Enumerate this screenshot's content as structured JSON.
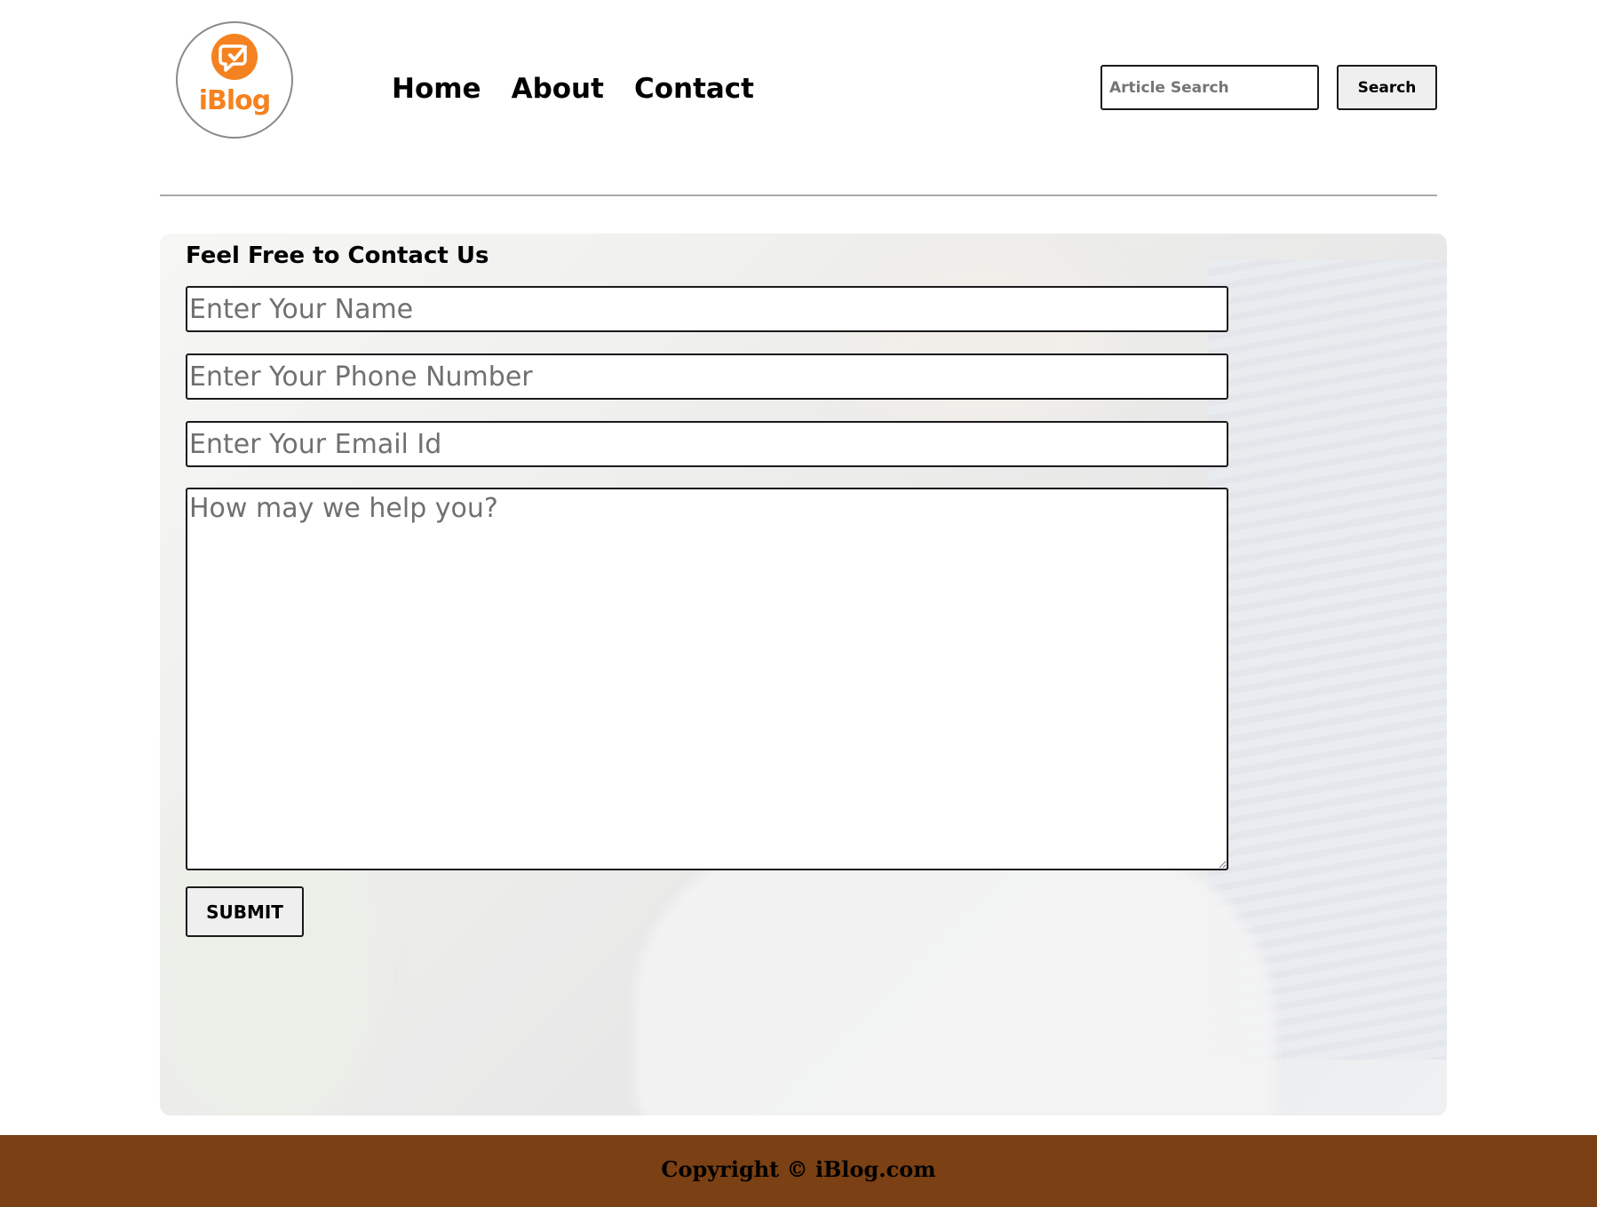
{
  "header": {
    "logo_text": "iBlog",
    "nav": [
      {
        "label": "Home"
      },
      {
        "label": "About"
      },
      {
        "label": "Contact"
      }
    ],
    "search": {
      "placeholder": "Article Search",
      "value": "",
      "button_label": "Search"
    }
  },
  "contact": {
    "title": "Feel Free to Contact Us",
    "name_placeholder": "Enter Your Name",
    "phone_placeholder": "Enter Your Phone Number",
    "email_placeholder": "Enter Your Email Id",
    "message_placeholder": "How may we help you?",
    "submit_label": "SUBMIT"
  },
  "footer": {
    "copyright": "Copyright © iBlog.com"
  },
  "colors": {
    "brand_orange": "#f58220",
    "footer_brown": "#7b4013"
  },
  "icons": {
    "logo_mark": "chat-edit-icon"
  }
}
